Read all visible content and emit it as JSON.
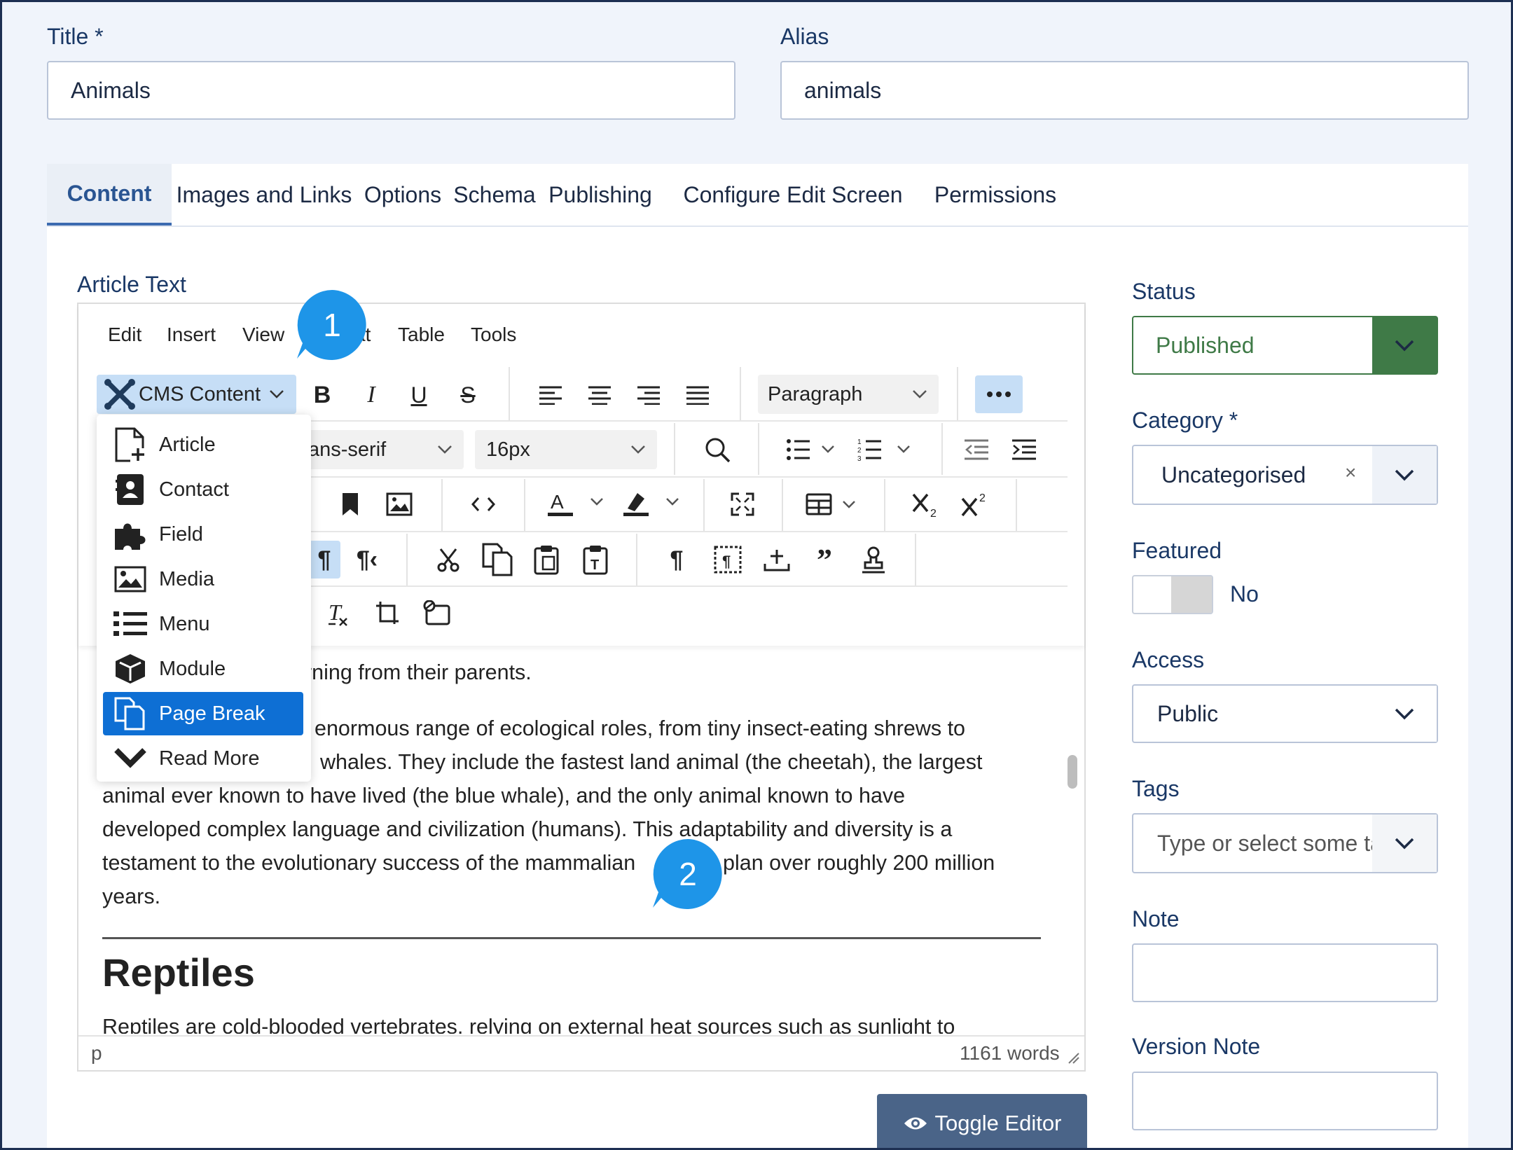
{
  "form": {
    "title_label": "Title *",
    "title_value": "Animals",
    "alias_label": "Alias",
    "alias_value": "animals"
  },
  "tabs": [
    {
      "label": "Content",
      "active": true
    },
    {
      "label": "Images and Links"
    },
    {
      "label": "Options"
    },
    {
      "label": "Schema"
    },
    {
      "label": "Publishing"
    },
    {
      "label": "Configure Edit Screen"
    },
    {
      "label": "Permissions"
    }
  ],
  "editor": {
    "label": "Article Text",
    "menu": [
      "Edit",
      "Insert",
      "View",
      "at",
      "Table",
      "Tools"
    ],
    "cms_content_label": "CMS Content",
    "block_format": "Paragraph",
    "font_family_partial": "ans-serif",
    "font_size": "16px",
    "dropdown_items": [
      {
        "label": "Article",
        "icon": "file-plus-icon"
      },
      {
        "label": "Contact",
        "icon": "address-card-icon"
      },
      {
        "label": "Field",
        "icon": "puzzle-icon"
      },
      {
        "label": "Media",
        "icon": "image-icon"
      },
      {
        "label": "Menu",
        "icon": "list-icon"
      },
      {
        "label": "Module",
        "icon": "cube-icon"
      },
      {
        "label": "Page Break",
        "icon": "copy-icon",
        "selected": true
      },
      {
        "label": "Read More",
        "icon": "chevron-down-icon"
      }
    ],
    "content": {
      "para1_tail": "rning from their parents.",
      "para2_lines": [
        "enormous range of ecological roles, from tiny insect-eating shrews to",
        "whales. They include the fastest land animal (the cheetah), the largest",
        "animal ever known to have lived (the blue whale), and the only animal known to have",
        "developed complex language and civilization (humans). This adaptability and diversity is a",
        "testament to the evolutionary success of the mammalian",
        "plan over roughly 200 million",
        "years."
      ],
      "heading": "Reptiles",
      "para3_line": "Reptiles are cold-blooded vertebrates, relying on external heat sources such as sunlight to"
    },
    "status_path": "p",
    "word_count": "1161 words",
    "toggle_label": "Toggle Editor"
  },
  "sidebar": {
    "status_label": "Status",
    "status_value": "Published",
    "category_label": "Category *",
    "category_value": "Uncategorised",
    "clear_symbol": "×",
    "featured_label": "Featured",
    "featured_value": "No",
    "access_label": "Access",
    "access_value": "Public",
    "tags_label": "Tags",
    "tags_placeholder": "Type or select some tags",
    "note_label": "Note",
    "version_note_label": "Version Note"
  },
  "callouts": [
    "1",
    "2"
  ],
  "colors": {
    "accent": "#2a5592",
    "published_green": "#3f7a47",
    "selection_blue": "#0e6fd4",
    "callout_blue": "#1e95e8",
    "toggle_button": "#4a6488"
  }
}
